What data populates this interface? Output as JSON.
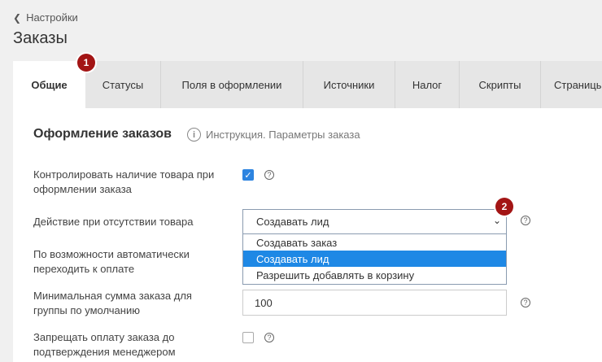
{
  "header": {
    "back_label": "Настройки",
    "title": "Заказы"
  },
  "tabs": [
    {
      "label": "Общие"
    },
    {
      "label": "Статусы"
    },
    {
      "label": "Поля в оформлении"
    },
    {
      "label": "Источники"
    },
    {
      "label": "Налог"
    },
    {
      "label": "Скрипты"
    },
    {
      "label": "Страницы"
    }
  ],
  "section": {
    "title": "Оформление заказов",
    "help_link": "Инструкция. Параметры заказа",
    "help_icon": "i"
  },
  "fields": {
    "check_stock": {
      "label_line1": "Контролировать наличие товара при",
      "label_line2": "оформлении заказа",
      "checked": true
    },
    "out_of_stock_action": {
      "label": "Действие при отсутствии товара",
      "value": "Создавать лид",
      "options": [
        "Создавать заказ",
        "Создавать лид",
        "Разрешить добавлять в корзину"
      ]
    },
    "auto_payment": {
      "label_line1": "По возможности автоматически",
      "label_line2": "переходить к оплате"
    },
    "min_sum": {
      "label_line1": "Минимальная сумма заказа для",
      "label_line2": "группы по умолчанию",
      "value": "100"
    },
    "forbid_payment": {
      "label_line1": "Запрещать оплату заказа до",
      "label_line2": "подтверждения менеджером",
      "checked": false
    }
  },
  "annotations": {
    "badge1": "1",
    "badge2": "2"
  },
  "glyphs": {
    "check": "✓",
    "question": "?",
    "chevron_left": "❮",
    "chevron_down": "⌄"
  }
}
